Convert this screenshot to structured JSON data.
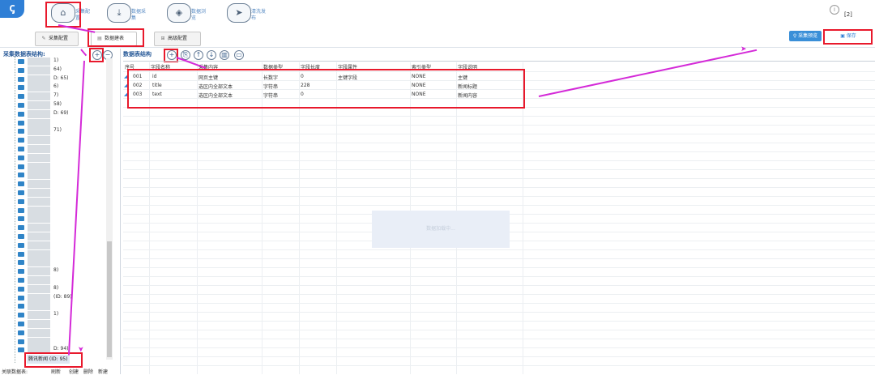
{
  "app": {
    "logo": "ꞔ",
    "version_badge": "[2]"
  },
  "nav": [
    {
      "icon": "⌂",
      "label": "采集配置"
    },
    {
      "icon": "⤓",
      "label": "数据采集"
    },
    {
      "icon": "◈",
      "label": "数据浏览"
    },
    {
      "icon": "➤",
      "label": "清洗发布"
    }
  ],
  "toolbar": {
    "collect_config": "采集配置",
    "data_table": "数据建表",
    "advanced_config": "高级配置",
    "preview_btn": "采集预览",
    "save_btn": "保存"
  },
  "left_panel": {
    "title": "采集数据表结构:",
    "tree_items": [
      {
        "text": "1)"
      },
      {
        "text": "64)"
      },
      {
        "text": "D: 65)"
      },
      {
        "text": "6)"
      },
      {
        "text": "7)"
      },
      {
        "text": "58)"
      },
      {
        "text": "D: 69)"
      },
      {
        "text": ""
      },
      {
        "text": "71)"
      },
      {
        "text": ""
      },
      {
        "text": ""
      },
      {
        "text": ""
      },
      {
        "text": ""
      },
      {
        "text": ""
      },
      {
        "text": ""
      },
      {
        "text": ""
      },
      {
        "text": ""
      },
      {
        "text": ""
      },
      {
        "text": ""
      },
      {
        "text": ""
      },
      {
        "text": ""
      },
      {
        "text": ""
      },
      {
        "text": ""
      },
      {
        "text": ""
      },
      {
        "text": "8)"
      },
      {
        "text": ""
      },
      {
        "text": "8)"
      },
      {
        "text": "(ID: 89)"
      },
      {
        "text": ""
      },
      {
        "text": "1)"
      },
      {
        "text": ""
      },
      {
        "text": ""
      },
      {
        "text": ""
      },
      {
        "text": "D: 94)"
      }
    ],
    "selected_item": "腾讯新闻 (ID: 95)",
    "footer_label": "关联数据表:",
    "footer_actions": [
      "刷新",
      "创建",
      "删除",
      "新建"
    ]
  },
  "right_panel": {
    "title": "数据表结构",
    "columns": [
      "序号",
      "字段名称",
      "采集内容",
      "数据类型",
      "字段长度",
      "字段属性",
      "索引类型",
      "字段说明"
    ],
    "rows": [
      [
        "001",
        "id",
        "网页主键",
        "长数字",
        "0",
        "主键字段",
        "NONE",
        "主键"
      ],
      [
        "002",
        "title",
        "选区内全部文本",
        "字符串",
        "228",
        "",
        "NONE",
        "新闻标题"
      ],
      [
        "003",
        "text",
        "选区内全部文本",
        "字符串",
        "0",
        "",
        "NONE",
        "新闻内容"
      ]
    ],
    "loading_text": "数据加载中..."
  },
  "colors": {
    "accent": "#2f7fd6",
    "highlight": "#e8192c",
    "annotation": "#d42ad8"
  }
}
